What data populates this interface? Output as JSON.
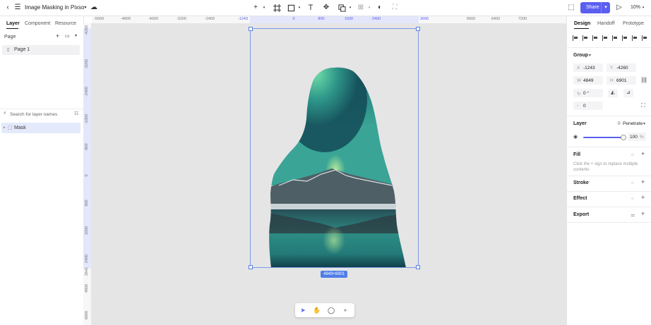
{
  "topbar": {
    "doc_title": "Image Masking in Pixso",
    "share_label": "Share",
    "zoom": "10%"
  },
  "left_panel": {
    "tabs": [
      "Layer",
      "Component",
      "Resource"
    ],
    "page_header": "Page",
    "pages": [
      "Page 1"
    ],
    "search_placeholder": "Search for layer names",
    "layers": [
      "Mask"
    ]
  },
  "rulers": {
    "horizontal": [
      "-5600",
      "-4800",
      "-4000",
      "-3200",
      "-2400",
      "-1243",
      "0",
      "800",
      "1600",
      "2400",
      "3606",
      "5600",
      "6400",
      "7200"
    ],
    "vertical": [
      "-4260",
      "-3200",
      "-2400",
      "-1600",
      "-800",
      "0",
      "800",
      "1600",
      "2400",
      "2641",
      "4800",
      "6000"
    ]
  },
  "canvas": {
    "size_badge": "4849×6901",
    "background": "#e5e5e5",
    "accent": "#5b5ff0"
  },
  "right_panel": {
    "tabs": [
      "Design",
      "Handoff",
      "Prototype"
    ],
    "group_title": "Group",
    "x_label": "X",
    "x_value": "-1243",
    "y_label": "Y",
    "y_value": "-4260",
    "w_label": "W",
    "w_value": "4849",
    "h_label": "H",
    "h_value": "6901",
    "rotation_value": "0 °",
    "radius_value": "0",
    "layer_title": "Layer",
    "blend_value": "0",
    "blend_mode": "Penetrate",
    "opacity_fraction": 1.0,
    "opacity_value": "100",
    "opacity_unit": "%",
    "fill_title": "Fill",
    "fill_hint": "Click the + sign to replace multiple contents",
    "stroke_title": "Stroke",
    "effect_title": "Effect",
    "export_title": "Export"
  }
}
